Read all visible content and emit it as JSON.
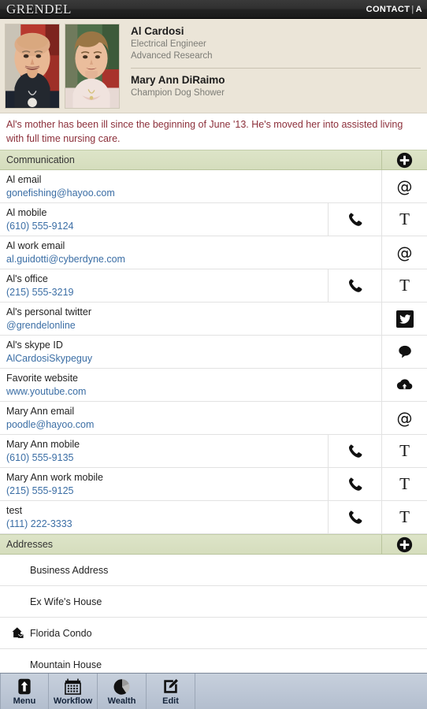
{
  "header": {
    "logo": "GRENDEL",
    "nav_primary": "CONTACT",
    "nav_separator": "|",
    "nav_secondary": "A"
  },
  "profile": {
    "people": [
      {
        "name": "Al Cardosi",
        "line1": "Electrical Engineer",
        "line2": "Advanced Research"
      },
      {
        "name": "Mary Ann DiRaimo",
        "line1": "Champion Dog Shower",
        "line2": ""
      }
    ]
  },
  "note": {
    "text": "Al's mother has been ill since the beginning of June '13.  He's moved her into assisted living with full time nursing care.",
    "color": "#8c2f3a"
  },
  "sections": [
    {
      "id": "communication",
      "title": "Communication",
      "add_icon": "plus-circle-icon",
      "rows": [
        {
          "label": "Al email",
          "value": "gonefishing@hayoo.com",
          "action1": "",
          "action2": "at-icon"
        },
        {
          "label": "Al mobile",
          "value": "(610) 555-9124",
          "action1": "phone-icon",
          "action2": "text-icon"
        },
        {
          "label": "Al work email",
          "value": "al.guidotti@cyberdyne.com",
          "action1": "",
          "action2": "at-icon"
        },
        {
          "label": "Al's office",
          "value": "(215) 555-3219",
          "action1": "phone-icon",
          "action2": "text-icon"
        },
        {
          "label": "Al's personal twitter",
          "value": "@grendelonline",
          "action1": "",
          "action2": "twitter-icon"
        },
        {
          "label": "Al's skype ID",
          "value": "AlCardosiSkypeguy",
          "action1": "",
          "action2": "skype-icon"
        },
        {
          "label": "Favorite website",
          "value": "www.youtube.com",
          "action1": "",
          "action2": "cloud-icon"
        },
        {
          "label": "Mary Ann email",
          "value": "poodle@hayoo.com",
          "action1": "",
          "action2": "at-icon"
        },
        {
          "label": "Mary Ann mobile",
          "value": "(610) 555-9135",
          "action1": "phone-icon",
          "action2": "text-icon"
        },
        {
          "label": "Mary Ann work mobile",
          "value": "(215) 555-9125",
          "action1": "phone-icon",
          "action2": "text-icon"
        },
        {
          "label": "test",
          "value": "(111) 222-3333",
          "action1": "phone-icon",
          "action2": "text-icon"
        }
      ]
    },
    {
      "id": "addresses",
      "title": "Addresses",
      "add_icon": "plus-circle-icon",
      "rows": [
        {
          "label": "Business Address",
          "icon": ""
        },
        {
          "label": "Ex Wife's House",
          "icon": ""
        },
        {
          "label": "Florida Condo",
          "icon": "home-icon"
        },
        {
          "label": "Mountain House",
          "icon": ""
        }
      ]
    }
  ],
  "toolbar": {
    "items": [
      {
        "label": "Menu",
        "icon": "up-arrow-icon"
      },
      {
        "label": "Workflow",
        "icon": "calendar-icon"
      },
      {
        "label": "Wealth",
        "icon": "pie-chart-icon"
      },
      {
        "label": "Edit",
        "icon": "pencil-square-icon"
      }
    ]
  },
  "colors": {
    "section_header": "#d9e0c5",
    "profile_bg": "#ebe5d8",
    "link": "#3b6ea5",
    "toolbar_bg": "#bdc7d6",
    "topbar_bg": "#262626"
  }
}
